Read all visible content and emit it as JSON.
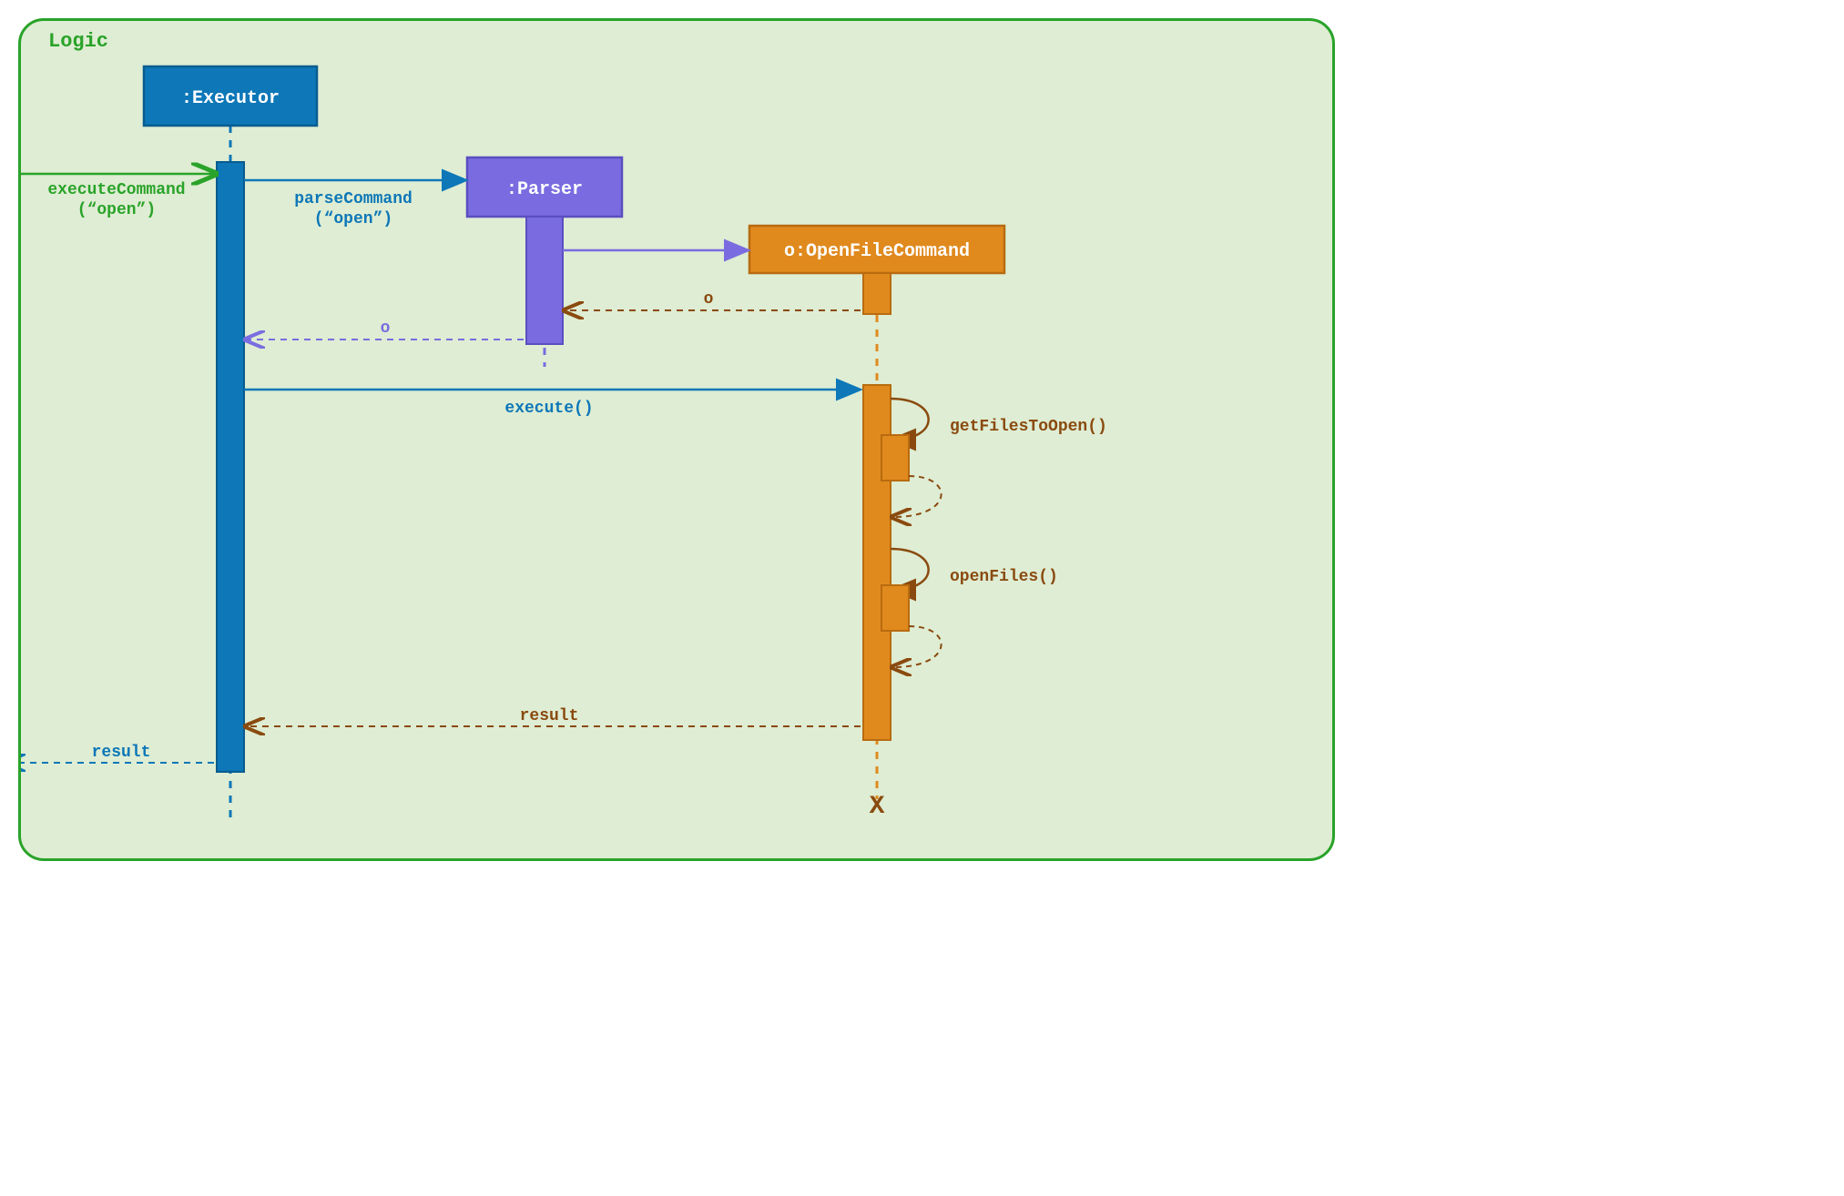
{
  "frame": {
    "label": "Logic"
  },
  "participants": {
    "executor": ":Executor",
    "parser": ":Parser",
    "command": "o:OpenFileCommand"
  },
  "messages": {
    "executeCommand1": "executeCommand",
    "executeCommand2": "(“open”)",
    "parseCommand1": "parseCommand",
    "parseCommand2": "(“open”)",
    "returnO": "o",
    "execute": "execute()",
    "getFilesToOpen": "getFilesToOpen()",
    "openFiles": "openFiles()",
    "result": "result"
  },
  "colors": {
    "green": "#29a329",
    "blue": "#0d77b8",
    "blueDark": "#0a5c8f",
    "purple": "#7a6ce0",
    "purpleDark": "#5b4ec0",
    "orange": "#e08a1e",
    "orangeDark": "#b86b0f",
    "brown": "#8a4a0f"
  }
}
